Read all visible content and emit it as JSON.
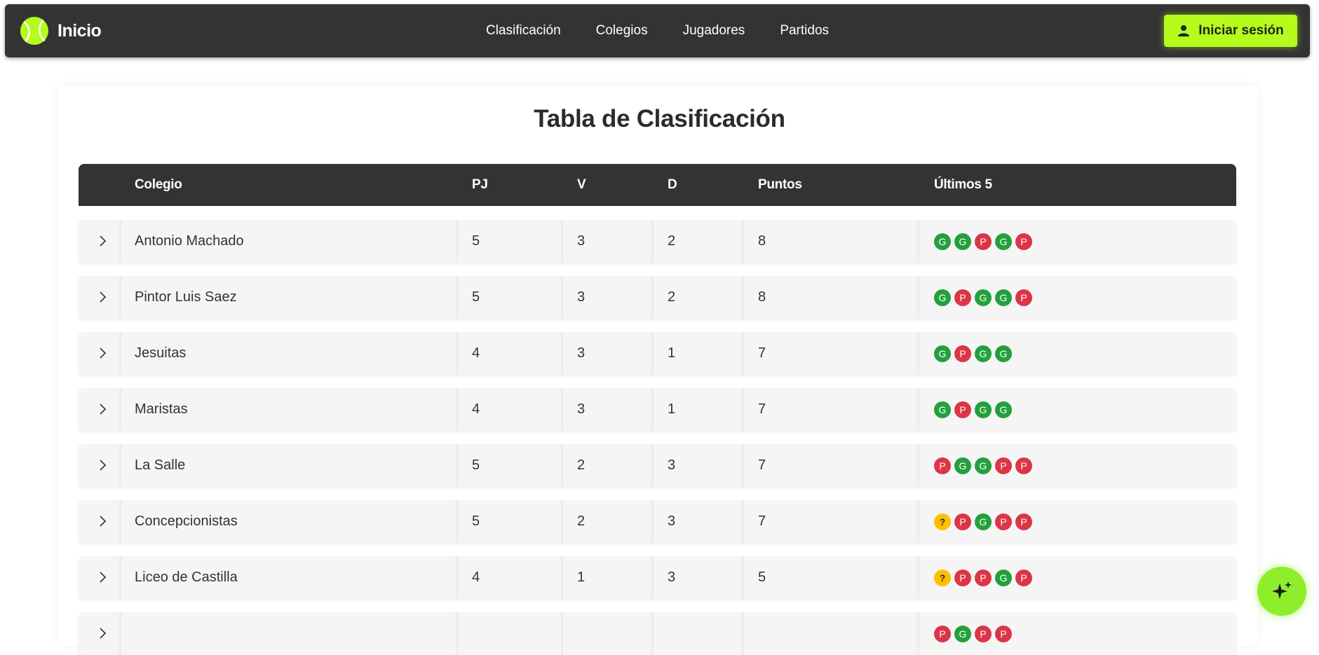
{
  "nav": {
    "brand": "Inicio",
    "links": [
      "Clasificación",
      "Colegios",
      "Jugadores",
      "Partidos"
    ],
    "login_label": "Iniciar sesión"
  },
  "page": {
    "title": "Tabla de Clasificación"
  },
  "table": {
    "headers": {
      "school": "Colegio",
      "pj": "PJ",
      "v": "V",
      "d": "D",
      "points": "Puntos",
      "last5": "Últimos 5"
    },
    "rows": [
      {
        "school": "Antonio Machado",
        "pj": "5",
        "v": "3",
        "d": "2",
        "points": "8",
        "last5": [
          "G",
          "G",
          "P",
          "G",
          "P"
        ]
      },
      {
        "school": "Pintor Luis Saez",
        "pj": "5",
        "v": "3",
        "d": "2",
        "points": "8",
        "last5": [
          "G",
          "P",
          "G",
          "G",
          "P"
        ]
      },
      {
        "school": "Jesuitas",
        "pj": "4",
        "v": "3",
        "d": "1",
        "points": "7",
        "last5": [
          "G",
          "P",
          "G",
          "G"
        ]
      },
      {
        "school": "Maristas",
        "pj": "4",
        "v": "3",
        "d": "1",
        "points": "7",
        "last5": [
          "G",
          "P",
          "G",
          "G"
        ]
      },
      {
        "school": "La Salle",
        "pj": "5",
        "v": "2",
        "d": "3",
        "points": "7",
        "last5": [
          "P",
          "G",
          "G",
          "P",
          "P"
        ]
      },
      {
        "school": "Concepcionistas",
        "pj": "5",
        "v": "2",
        "d": "3",
        "points": "7",
        "last5": [
          "?",
          "P",
          "G",
          "P",
          "P"
        ]
      },
      {
        "school": "Liceo de Castilla",
        "pj": "4",
        "v": "1",
        "d": "3",
        "points": "5",
        "last5": [
          "?",
          "P",
          "P",
          "G",
          "P"
        ]
      }
    ],
    "partial_row": {
      "school": "",
      "pj": "",
      "v": "",
      "d": "",
      "points": "",
      "last5": [
        "P",
        "G",
        "P",
        "P"
      ]
    }
  },
  "colors": {
    "navbar_bg": "#333333",
    "accent": "#b5fb1b",
    "win": "#22a03c",
    "loss": "#dc3545",
    "pending": "#ffbf00",
    "row_bg": "#f5f5f6"
  },
  "icons": {
    "brand": "tennis-ball-icon",
    "login": "user-icon",
    "row_expand": "chevron-right-icon",
    "fab": "sparkle-icon"
  }
}
